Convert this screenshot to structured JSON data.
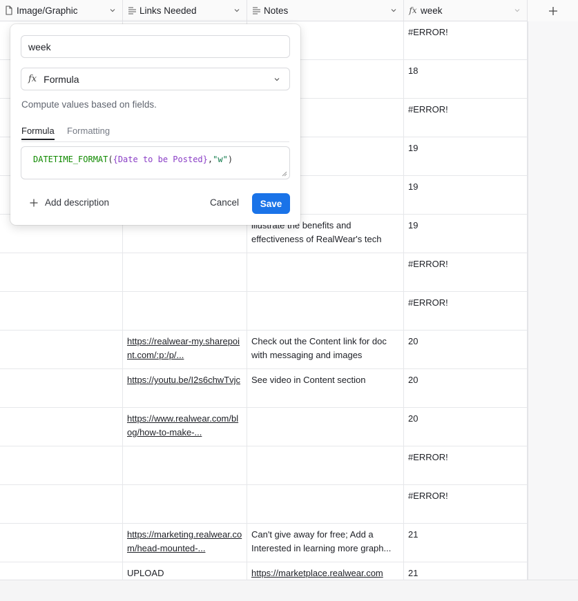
{
  "columns": [
    {
      "label": "Image/Graphic",
      "icon": "document-icon"
    },
    {
      "label": "Links Needed",
      "icon": "long-text-icon"
    },
    {
      "label": "Notes",
      "icon": "long-text-icon"
    },
    {
      "label": "week",
      "icon": "formula-icon"
    }
  ],
  "rows": [
    {
      "links": "",
      "notes": "",
      "week": "#ERROR!"
    },
    {
      "links": "",
      "notes": "",
      "week": "18"
    },
    {
      "links": "",
      "notes": "",
      "week": "#ERROR!"
    },
    {
      "links": "",
      "notes": "",
      "week": "19"
    },
    {
      "links": "",
      "notes": "",
      "week": "19"
    },
    {
      "links": "",
      "notes": "illustrate the benefits and effectiveness of RealWear's tech",
      "week": "19"
    },
    {
      "links": "",
      "notes": "",
      "week": "#ERROR!"
    },
    {
      "links": "",
      "notes": "",
      "week": "#ERROR!"
    },
    {
      "links": "https://realwear-my.sharepoint.com/:p:/p/...",
      "notes": "Check out the Content link for doc with messaging and images",
      "week": "20"
    },
    {
      "links": "https://youtu.be/I2s6chwTvjc",
      "notes": "See video in Content section",
      "week": "20"
    },
    {
      "links": "https://www.realwear.com/blog/how-to-make-...",
      "notes": "",
      "week": "20"
    },
    {
      "links": "",
      "notes": "",
      "week": "#ERROR!"
    },
    {
      "links": "",
      "notes": "",
      "week": "#ERROR!"
    },
    {
      "links": "https://marketing.realwear.com/head-mounted-...",
      "notes": "Can't give away for free; Add a Interested in learning more graph...",
      "week": "21"
    },
    {
      "links": "UPLOAD",
      "notes": "https://marketplace.realwear.com",
      "week": "21"
    }
  ],
  "popover": {
    "field_name": "week",
    "field_type": "Formula",
    "hint": "Compute values based on fields.",
    "tabs": [
      "Formula",
      "Formatting"
    ],
    "formula": {
      "fn": "DATETIME_FORMAT",
      "open": "(",
      "field": "{Date to be Posted}",
      "comma": ",",
      "str": "\"w\"",
      "close": ")"
    },
    "add_description": "Add description",
    "cancel": "Cancel",
    "save": "Save"
  }
}
